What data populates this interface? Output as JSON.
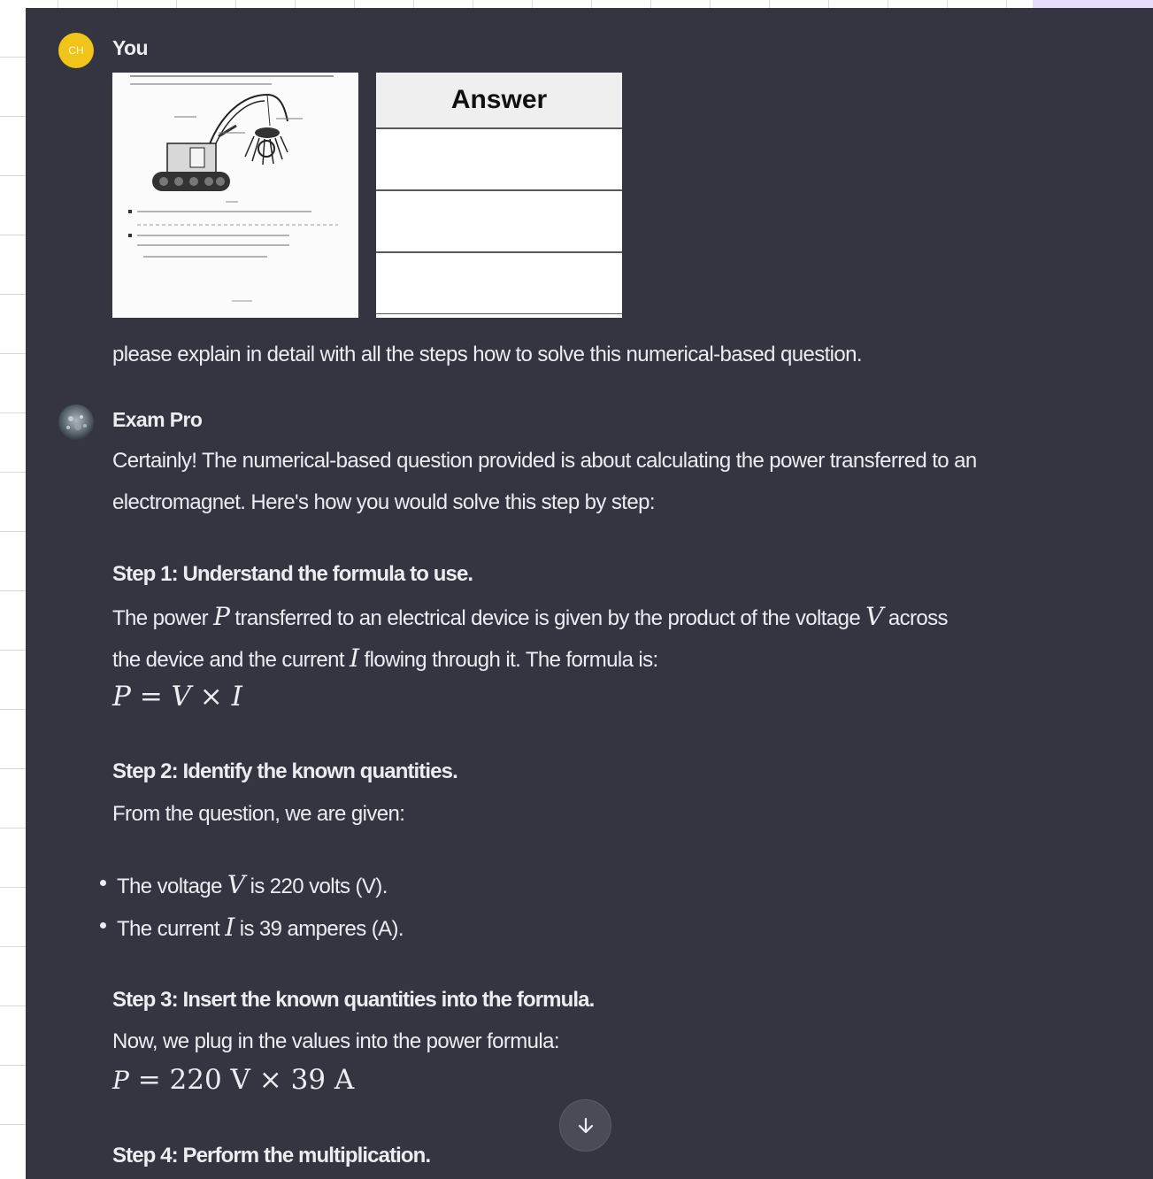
{
  "conversation": {
    "user": {
      "initials": "CH",
      "name": "You",
      "attachments": {
        "answer_table_header": "Answer",
        "answer_rows": 3
      },
      "prompt": "please explain in detail with all the steps how to solve this numerical-based question."
    },
    "assistant": {
      "name": "Exam Pro",
      "intro_line1": "Certainly! The numerical-based question provided is about calculating the power transferred to an",
      "intro_line2": "electromagnet. Here's how you would solve this step by step:",
      "step1": {
        "title": "Step 1: Understand the formula to use.",
        "text_a": "The power ",
        "var_p": "P",
        "text_b": " transferred to an electrical device is given by the product of the voltage ",
        "var_v": "V",
        "text_c": " across",
        "text_d": "the device and the current ",
        "var_i": "I",
        "text_e": " flowing through it. The formula is:",
        "formula": "P = V × I"
      },
      "step2": {
        "title": "Step 2: Identify the known quantities.",
        "text": "From the question, we are given:",
        "bullet1_a": "The voltage ",
        "bullet1_var": "V",
        "bullet1_b": " is 220 volts (V).",
        "bullet2_a": "The current ",
        "bullet2_var": "I",
        "bullet2_b": " is 39 amperes (A)."
      },
      "step3": {
        "title": "Step 3: Insert the known quantities into the formula.",
        "text": "Now, we plug in the values into the power formula:",
        "formula_lhs": "P",
        "formula_rhs": " = 220 V × 39 A"
      },
      "step4": {
        "title": "Step 4: Perform the multiplication."
      }
    }
  },
  "icons": {
    "scroll_down": "arrow-down-icon"
  },
  "colors": {
    "panel_bg": "#343541",
    "text": "#ececf1",
    "user_avatar": "#f0c419",
    "corner_accent": "#e6dcfb"
  }
}
